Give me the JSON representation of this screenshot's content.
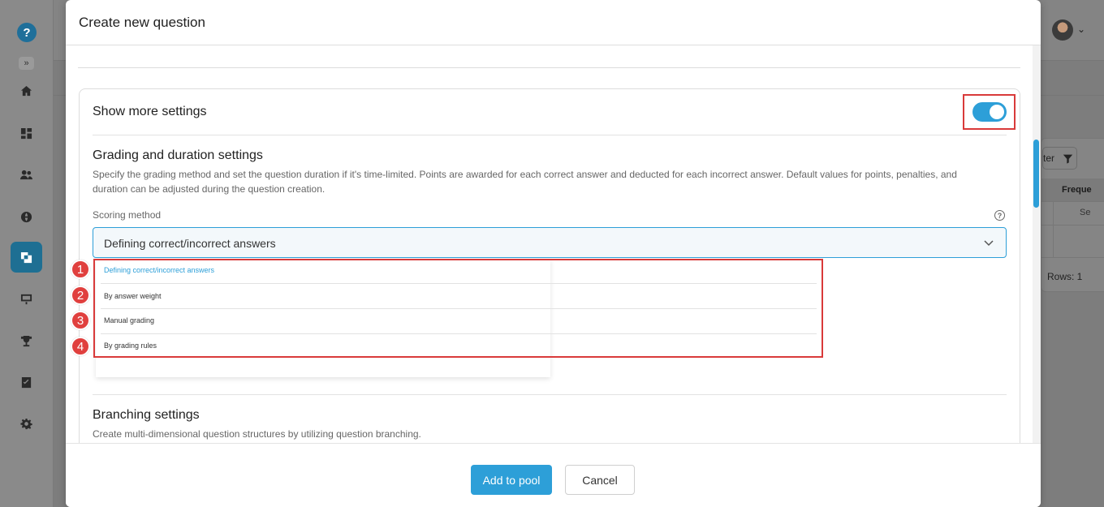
{
  "modal": {
    "title": "Create new question"
  },
  "settings": {
    "title": "Show more settings",
    "toggle_on": true
  },
  "grading": {
    "title": "Grading and duration settings",
    "description": "Specify the grading method and set the question duration if it's time-limited. Points are awarded for each correct answer and deducted for each incorrect answer. Default values for points, penalties, and duration can be adjusted during the question creation.",
    "scoring_label": "Scoring method",
    "help_icon": "?",
    "selected": "Defining correct/incorrect answers",
    "options": [
      {
        "number": "1",
        "label": "Defining correct/incorrect answers"
      },
      {
        "number": "2",
        "label": "By answer weight"
      },
      {
        "number": "3",
        "label": "Manual grading"
      },
      {
        "number": "4",
        "label": "By grading rules"
      }
    ]
  },
  "branching": {
    "title": "Branching settings",
    "description": "Create multi-dimensional question structures by utilizing question branching."
  },
  "footer": {
    "add_label": "Add to pool",
    "cancel_label": "Cancel"
  },
  "background": {
    "filter_label": "ter",
    "column_header": "Freque",
    "cell_value": "Se",
    "rows_label": "Rows: 1"
  },
  "colors": {
    "accent": "#2d9fd8",
    "highlight": "#d93a3a",
    "badge": "#e0403e"
  },
  "icons": [
    "logo-icon",
    "expand-icon",
    "home-icon",
    "dashboard-icon",
    "users-icon",
    "globe-icon",
    "question-pool-icon",
    "presentation-icon",
    "trophy-icon",
    "checklist-icon",
    "gear-icon",
    "avatar",
    "chevron-down-icon",
    "filter-icon",
    "help-icon"
  ]
}
